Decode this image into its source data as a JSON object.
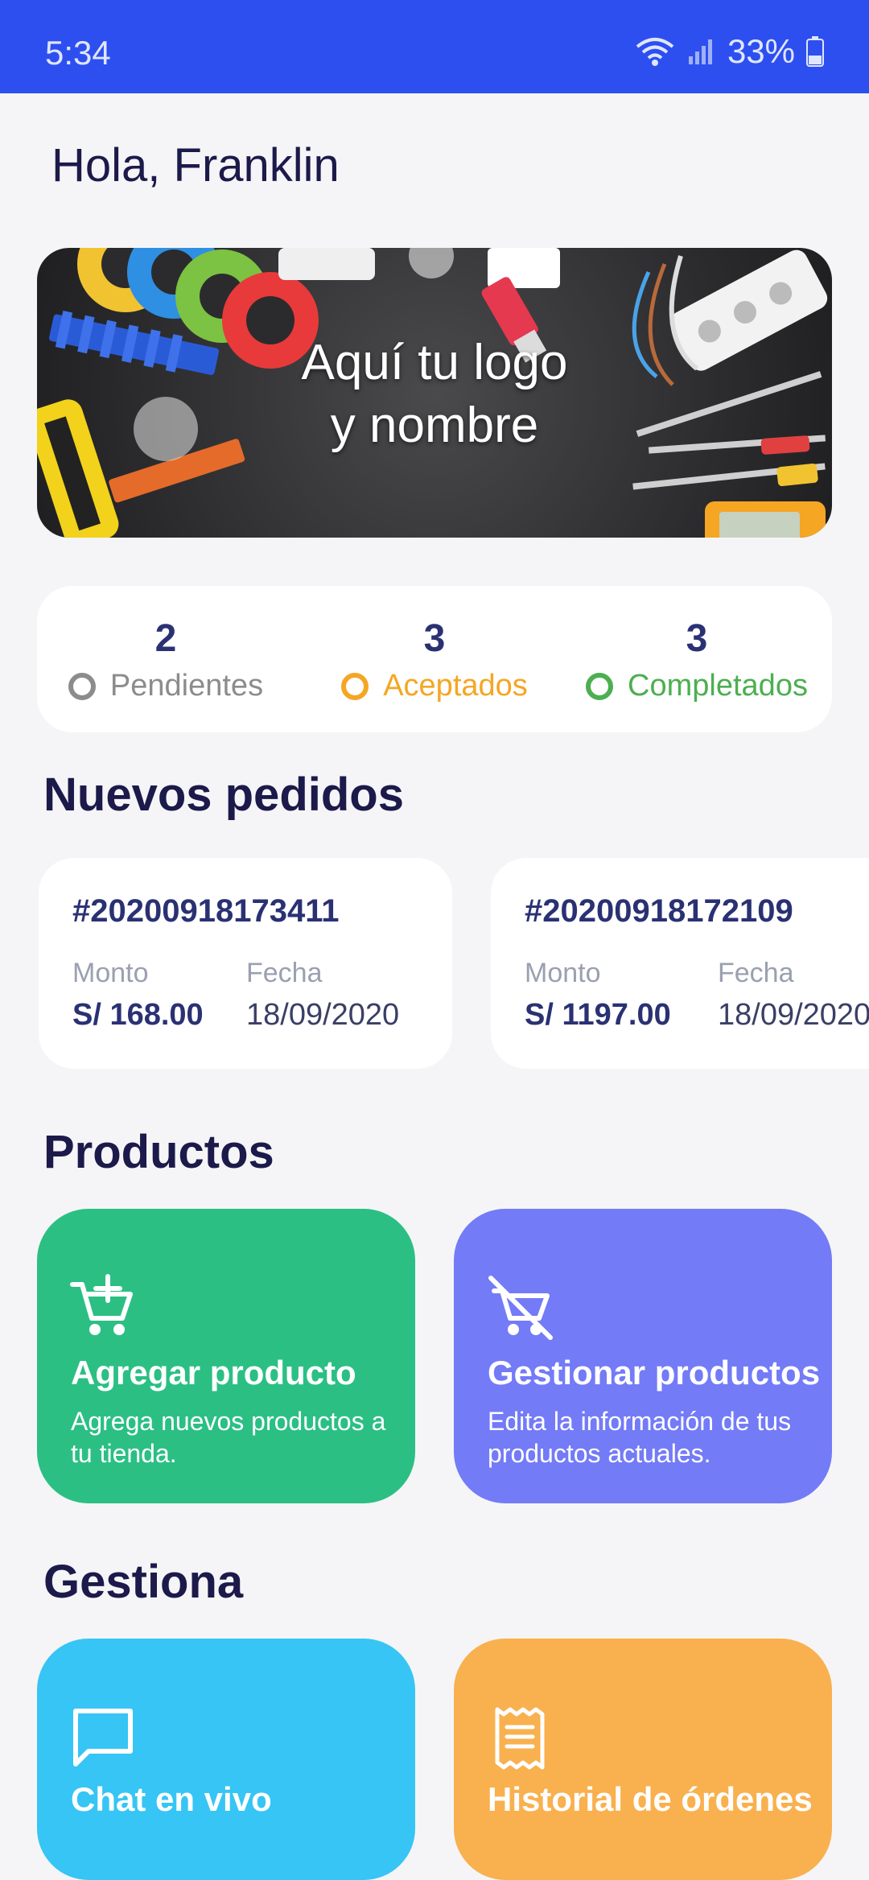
{
  "status_bar": {
    "time": "5:34",
    "battery": "33%"
  },
  "greeting": "Hola, Franklin",
  "banner": {
    "line1": "Aquí tu logo",
    "line2": "y nombre"
  },
  "stats": [
    {
      "count": "2",
      "label": "Pendientes",
      "color": "#8c8c8c"
    },
    {
      "count": "3",
      "label": "Aceptados",
      "color": "#f5a623"
    },
    {
      "count": "3",
      "label": "Completados",
      "color": "#4caf50"
    }
  ],
  "orders_section": "Nuevos pedidos",
  "orders": [
    {
      "id": "#20200918173411",
      "amount_label": "Monto",
      "amount": "S/ 168.00",
      "date_label": "Fecha",
      "date": "18/09/2020"
    },
    {
      "id": "#20200918172109",
      "amount_label": "Monto",
      "amount": "S/ 1197.00",
      "date_label": "Fecha",
      "date": "18/09/2020"
    }
  ],
  "products_section": "Productos",
  "product_tiles": [
    {
      "title": "Agregar producto",
      "desc": "Agrega nuevos productos a tu tienda.",
      "icon": "add-cart-icon",
      "color": "#2bbf84"
    },
    {
      "title": "Gestionar productos",
      "desc": "Edita la información de tus productos actuales.",
      "icon": "remove-cart-icon",
      "color": "#737bf7"
    }
  ],
  "manage_section": "Gestiona",
  "manage_tiles": [
    {
      "title": "Chat en vivo",
      "icon": "chat-icon",
      "color": "#36c5f4"
    },
    {
      "title": "Historial de órdenes",
      "icon": "receipt-icon",
      "color": "#f9b04e"
    }
  ]
}
